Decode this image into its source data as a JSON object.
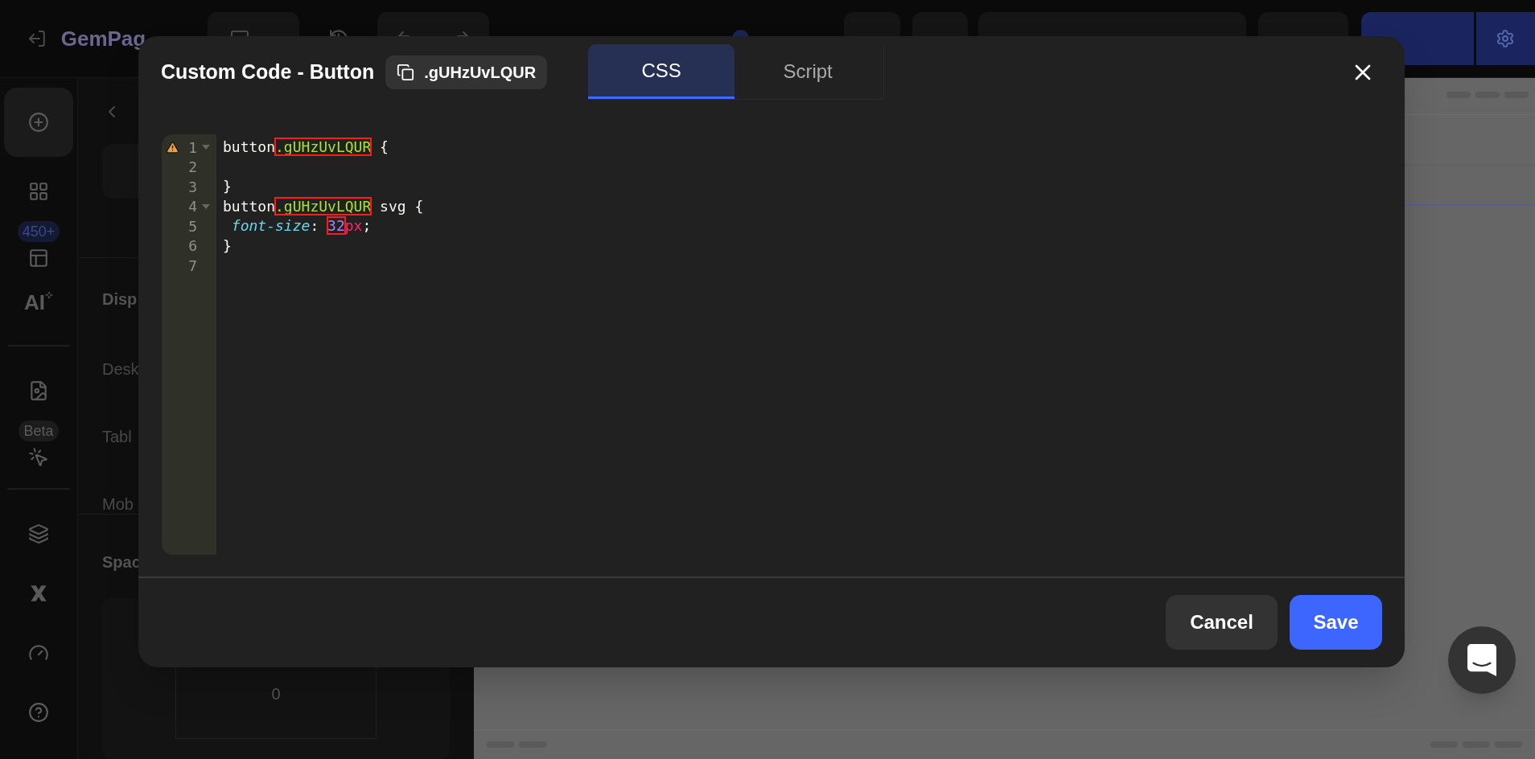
{
  "topbar": {
    "app_name": "GemPag"
  },
  "rail": {
    "items": [
      {
        "kind": "add",
        "selected": true
      },
      {
        "kind": "elements",
        "selected": false
      },
      {
        "kind": "templates",
        "badge": "450+",
        "selected": false
      },
      {
        "kind": "ai",
        "label": "AI",
        "selected": false
      },
      {
        "kind": "divider"
      },
      {
        "kind": "pages",
        "selected": false
      },
      {
        "kind": "picker",
        "badge": "Beta",
        "selected": false
      },
      {
        "kind": "divider"
      },
      {
        "kind": "layers",
        "selected": false
      },
      {
        "kind": "variables",
        "selected": false
      },
      {
        "kind": "speed",
        "selected": false
      },
      {
        "kind": "help",
        "selected": false
      }
    ]
  },
  "panel": {
    "section_title": "Disp",
    "rows": [
      "Desk",
      "Tabl",
      "Mob"
    ],
    "spacing_title": "Spac",
    "spacing_value": "0"
  },
  "modal": {
    "title": "Custom Code - Button",
    "class_chip": ".gUHzUvLQUR",
    "tabs": [
      {
        "label": "CSS",
        "selected": true
      },
      {
        "label": "Script",
        "selected": false
      }
    ],
    "editor": {
      "lines": [
        {
          "number": "1",
          "warning": true,
          "foldable": true,
          "tokens": [
            {
              "kind": "plain",
              "text": "button",
              "flagged": false
            },
            {
              "kind": "class",
              "text": ".gUHzUvLQUR",
              "flagged": true
            },
            {
              "kind": "plain",
              "text": " {",
              "flagged": false
            }
          ]
        },
        {
          "number": "2",
          "warning": false,
          "foldable": false
        },
        {
          "number": "3",
          "warning": false,
          "foldable": false,
          "tokens": [
            {
              "kind": "plain",
              "text": "}",
              "flagged": false
            }
          ]
        },
        {
          "number": "4",
          "warning": false,
          "foldable": true,
          "tokens": [
            {
              "kind": "plain",
              "text": "button",
              "flagged": false
            },
            {
              "kind": "class",
              "text": ".gUHzUvLQUR",
              "flagged": true
            },
            {
              "kind": "plain",
              "text": " svg {",
              "flagged": false
            }
          ]
        },
        {
          "number": "5",
          "warning": false,
          "foldable": false,
          "tokens": [
            {
              "kind": "property",
              "text": " font-size",
              "flagged": false
            },
            {
              "kind": "plain",
              "text": ": ",
              "flagged": false
            },
            {
              "kind": "number",
              "text": "32",
              "flagged": true
            },
            {
              "kind": "unit",
              "text": "px",
              "flagged": false
            },
            {
              "kind": "plain",
              "text": ";",
              "flagged": false
            }
          ]
        },
        {
          "number": "6",
          "warning": false,
          "foldable": false,
          "tokens": [
            {
              "kind": "plain",
              "text": "}",
              "flagged": false
            }
          ]
        },
        {
          "number": "7",
          "warning": false,
          "foldable": false
        }
      ]
    },
    "buttons": {
      "cancel": "Cancel",
      "save": "Save"
    }
  }
}
